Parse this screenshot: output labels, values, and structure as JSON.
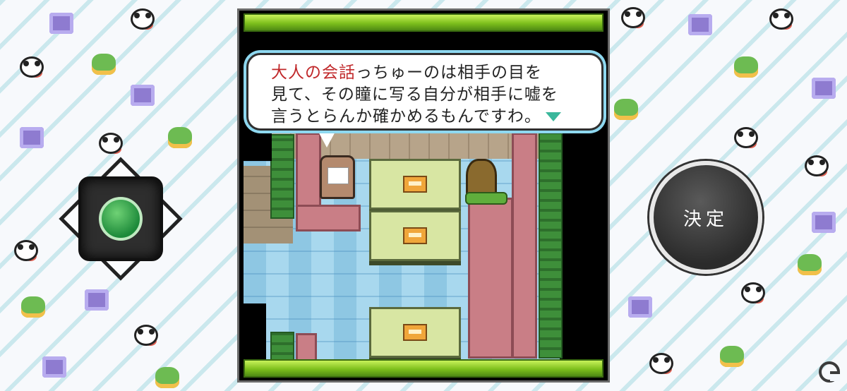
{
  "dialog": {
    "line1_highlight": "大人の会話",
    "line1_rest": "っちゅーのは相手の目を",
    "line2": "見て、その瞳に写る自分が相手に嘘を",
    "line3": "言うとらんか確かめるもんですわ。",
    "highlight_color": "#c0282a",
    "advance_icon": "triangle-down-icon"
  },
  "controls": {
    "decide_label": "決定",
    "dpad_icon": "dpad-icon"
  },
  "colors": {
    "accent_green": "#7dbf1c",
    "dialog_border": "#8ed8f0"
  },
  "watermark_icon": "g-logo-icon"
}
